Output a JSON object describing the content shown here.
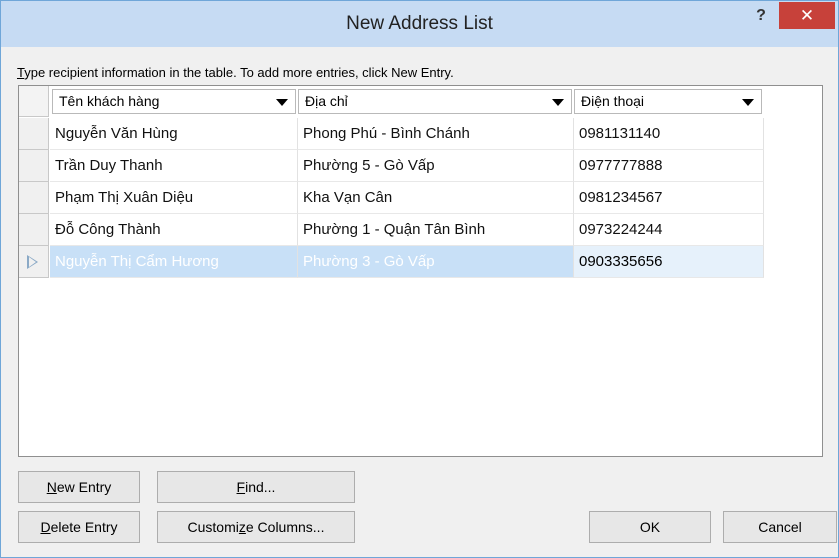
{
  "window": {
    "title": "New Address List",
    "help_label": "?",
    "close_label": "✕"
  },
  "instruction": {
    "first_letter": "T",
    "rest": "ype recipient information in the table.  To add more entries, click New Entry."
  },
  "columns": [
    {
      "label": "Tên khách hàng"
    },
    {
      "label": "Địa chỉ"
    },
    {
      "label": "Điện thoại"
    }
  ],
  "rows": [
    {
      "name": "Nguyễn Văn Hùng",
      "address": "Phong Phú - Bình Chánh",
      "phone": "0981131140",
      "selected": false
    },
    {
      "name": "Trần Duy Thanh",
      "address": "Phường 5 - Gò Vấp",
      "phone": "0977777888",
      "selected": false
    },
    {
      "name": "Phạm Thị Xuân Diệu",
      "address": "Kha Vạn Cân",
      "phone": "0981234567",
      "selected": false
    },
    {
      "name": "Đỗ Công Thành",
      "address": "Phường 1 - Quận Tân Bình",
      "phone": "0973224244",
      "selected": false
    },
    {
      "name": "Nguyễn Thị Cẩm Hương",
      "address": "Phường 3 - Gò Vấp",
      "phone": "0903335656",
      "selected": true
    }
  ],
  "buttons": {
    "new_entry": {
      "u": "N",
      "rest": "ew Entry"
    },
    "find": {
      "u": "F",
      "rest": "ind..."
    },
    "delete_entry": {
      "u": "D",
      "rest": "elete Entry"
    },
    "customize_pre": "Customi",
    "customize_u": "z",
    "customize_post": "e Columns...",
    "ok": "OK",
    "cancel": "Cancel"
  }
}
